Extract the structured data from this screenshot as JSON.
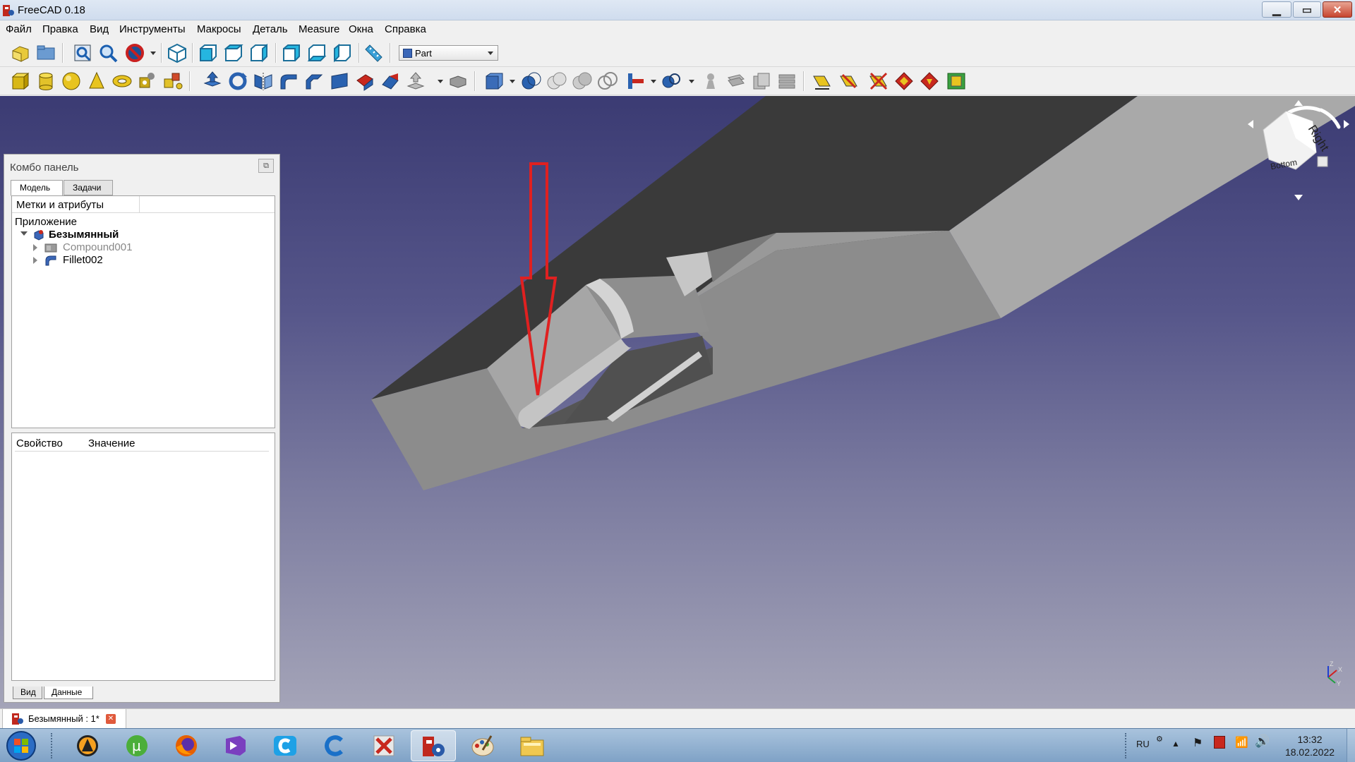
{
  "window": {
    "title": "FreeCAD 0.18"
  },
  "menu": [
    "Файл",
    "Правка",
    "Вид",
    "Инструменты",
    "Макросы",
    "Деталь",
    "Measure",
    "Окна",
    "Справка"
  ],
  "workbench": {
    "selected": "Part"
  },
  "combo": {
    "title": "Комбо панель",
    "tabs": [
      "Модель",
      "Задачи"
    ],
    "tree_header": "Метки и атрибуты",
    "tree": {
      "root": "Приложение",
      "document": "Безымянный",
      "items": [
        "Compound001",
        "Fillet002"
      ]
    },
    "props_header": {
      "property": "Свойство",
      "value": "Значение"
    },
    "bottom_tabs": [
      "Вид",
      "Данные"
    ]
  },
  "navcube": {
    "face_right": "Right",
    "face_bottom": "Bottom"
  },
  "axes": {
    "x": "X",
    "y": "Y",
    "z": "Z"
  },
  "document_tab": {
    "label": "Безымянный : 1*"
  },
  "taskbar": {
    "apps": [
      "aimp",
      "utorrent",
      "firefox",
      "visual-studio",
      "ccleaner",
      "ccleaner-browser",
      "kaspersky",
      "freecad",
      "paint",
      "explorer"
    ]
  },
  "tray": {
    "lang": "RU",
    "time": "13:32",
    "date": "18.02.2022"
  },
  "colors": {
    "viewport_top": "#3b3b73",
    "viewport_bottom": "#a4a4b8",
    "arrow": "#e02020",
    "model_face": "#909090"
  }
}
